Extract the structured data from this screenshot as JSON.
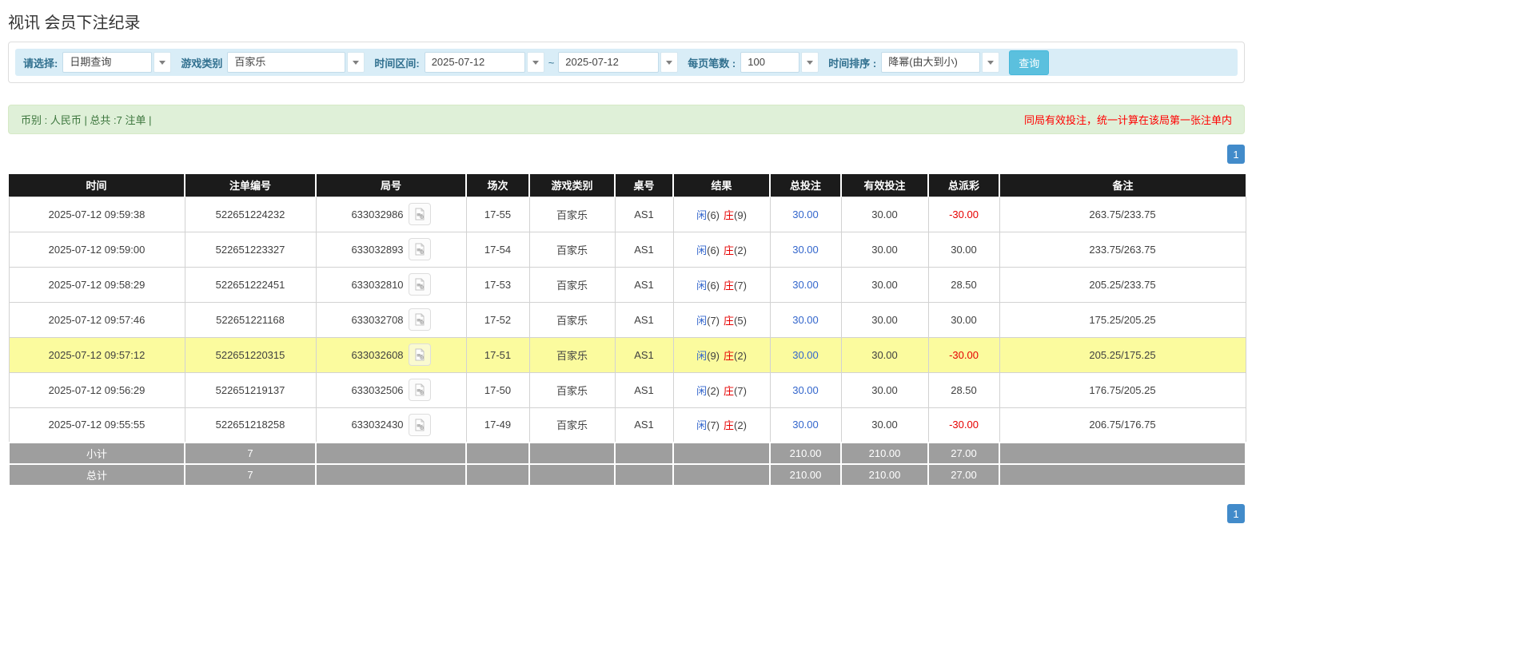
{
  "page": {
    "title": "视讯 会员下注纪录"
  },
  "filter": {
    "select_label": "请选择:",
    "select_value": "日期查询",
    "game_type_label": "游戏类别",
    "game_type_value": "百家乐",
    "time_range_label": "时间区间:",
    "date_from": "2025-07-12",
    "tilde": "~",
    "date_to": "2025-07-12",
    "page_size_label": "每页笔数 :",
    "page_size_value": "100",
    "sort_label": "时间排序 :",
    "sort_value": "降幂(由大到小)",
    "search_button_label": "查询"
  },
  "summary_bar": {
    "left_text": "币别 : 人民币 | 总共 :7 注单 |",
    "right_notice": "同局有效投注，统一计算在该局第一张注单内"
  },
  "pagination": {
    "current_page": "1"
  },
  "icons": {
    "video_button": "film-document-icon",
    "combo_arrow": "chevron-down-icon"
  },
  "table": {
    "headers": [
      "时间",
      "注单编号",
      "局号",
      "场次",
      "游戏类别",
      "桌号",
      "结果",
      "总投注",
      "有效投注",
      "总派彩",
      "备注"
    ],
    "rows": [
      {
        "time": "2025-07-12 09:59:38",
        "bet_id": "522651224232",
        "round_id": "633032986",
        "session": "17-55",
        "game_type": "百家乐",
        "table_no": "AS1",
        "p_label": "闲",
        "p_num": "(6)",
        "b_label": "庄",
        "b_num": "(9)",
        "total_bet": "30.00",
        "valid_bet": "30.00",
        "payout": "-30.00",
        "remark": "263.75/233.75",
        "highlighted": false
      },
      {
        "time": "2025-07-12 09:59:00",
        "bet_id": "522651223327",
        "round_id": "633032893",
        "session": "17-54",
        "game_type": "百家乐",
        "table_no": "AS1",
        "p_label": "闲",
        "p_num": "(6)",
        "b_label": "庄",
        "b_num": "(2)",
        "total_bet": "30.00",
        "valid_bet": "30.00",
        "payout": "30.00",
        "remark": "233.75/263.75",
        "highlighted": false
      },
      {
        "time": "2025-07-12 09:58:29",
        "bet_id": "522651222451",
        "round_id": "633032810",
        "session": "17-53",
        "game_type": "百家乐",
        "table_no": "AS1",
        "p_label": "闲",
        "p_num": "(6)",
        "b_label": "庄",
        "b_num": "(7)",
        "total_bet": "30.00",
        "valid_bet": "30.00",
        "payout": "28.50",
        "remark": "205.25/233.75",
        "highlighted": false
      },
      {
        "time": "2025-07-12 09:57:46",
        "bet_id": "522651221168",
        "round_id": "633032708",
        "session": "17-52",
        "game_type": "百家乐",
        "table_no": "AS1",
        "p_label": "闲",
        "p_num": "(7)",
        "b_label": "庄",
        "b_num": "(5)",
        "total_bet": "30.00",
        "valid_bet": "30.00",
        "payout": "30.00",
        "remark": "175.25/205.25",
        "highlighted": false
      },
      {
        "time": "2025-07-12 09:57:12",
        "bet_id": "522651220315",
        "round_id": "633032608",
        "session": "17-51",
        "game_type": "百家乐",
        "table_no": "AS1",
        "p_label": "闲",
        "p_num": "(9)",
        "b_label": "庄",
        "b_num": "(2)",
        "total_bet": "30.00",
        "valid_bet": "30.00",
        "payout": "-30.00",
        "remark": "205.25/175.25",
        "highlighted": true
      },
      {
        "time": "2025-07-12 09:56:29",
        "bet_id": "522651219137",
        "round_id": "633032506",
        "session": "17-50",
        "game_type": "百家乐",
        "table_no": "AS1",
        "p_label": "闲",
        "p_num": "(2)",
        "b_label": "庄",
        "b_num": "(7)",
        "total_bet": "30.00",
        "valid_bet": "30.00",
        "payout": "28.50",
        "remark": "176.75/205.25",
        "highlighted": false
      },
      {
        "time": "2025-07-12 09:55:55",
        "bet_id": "522651218258",
        "round_id": "633032430",
        "session": "17-49",
        "game_type": "百家乐",
        "table_no": "AS1",
        "p_label": "闲",
        "p_num": "(7)",
        "b_label": "庄",
        "b_num": "(2)",
        "total_bet": "30.00",
        "valid_bet": "30.00",
        "payout": "-30.00",
        "remark": "206.75/176.75",
        "highlighted": false
      }
    ],
    "subtotal_row": {
      "label": "小计",
      "count": "7",
      "total_bet": "210.00",
      "valid_bet": "210.00",
      "payout": "27.00"
    },
    "total_row": {
      "label": "总计",
      "count": "7",
      "total_bet": "210.00",
      "valid_bet": "210.00",
      "payout": "27.00"
    }
  },
  "colors": {
    "header_bg": "#1b1b1b",
    "highlight_row": "#fbfb9e",
    "subtotal_bg": "#9e9e9e",
    "link_blue": "#3366cc",
    "player_blue": "#3366cc",
    "banker_red": "#e60000",
    "negative_red": "#e60000",
    "accent_button": "#5bc0de",
    "pagination_bg": "#428bca",
    "filter_bar_bg": "#d9edf7",
    "filter_label": "#31708f",
    "summary_bg": "#dff0d8",
    "summary_border": "#d6e9c6",
    "summary_text": "#3c763d",
    "notice_red": "#ff0000"
  }
}
